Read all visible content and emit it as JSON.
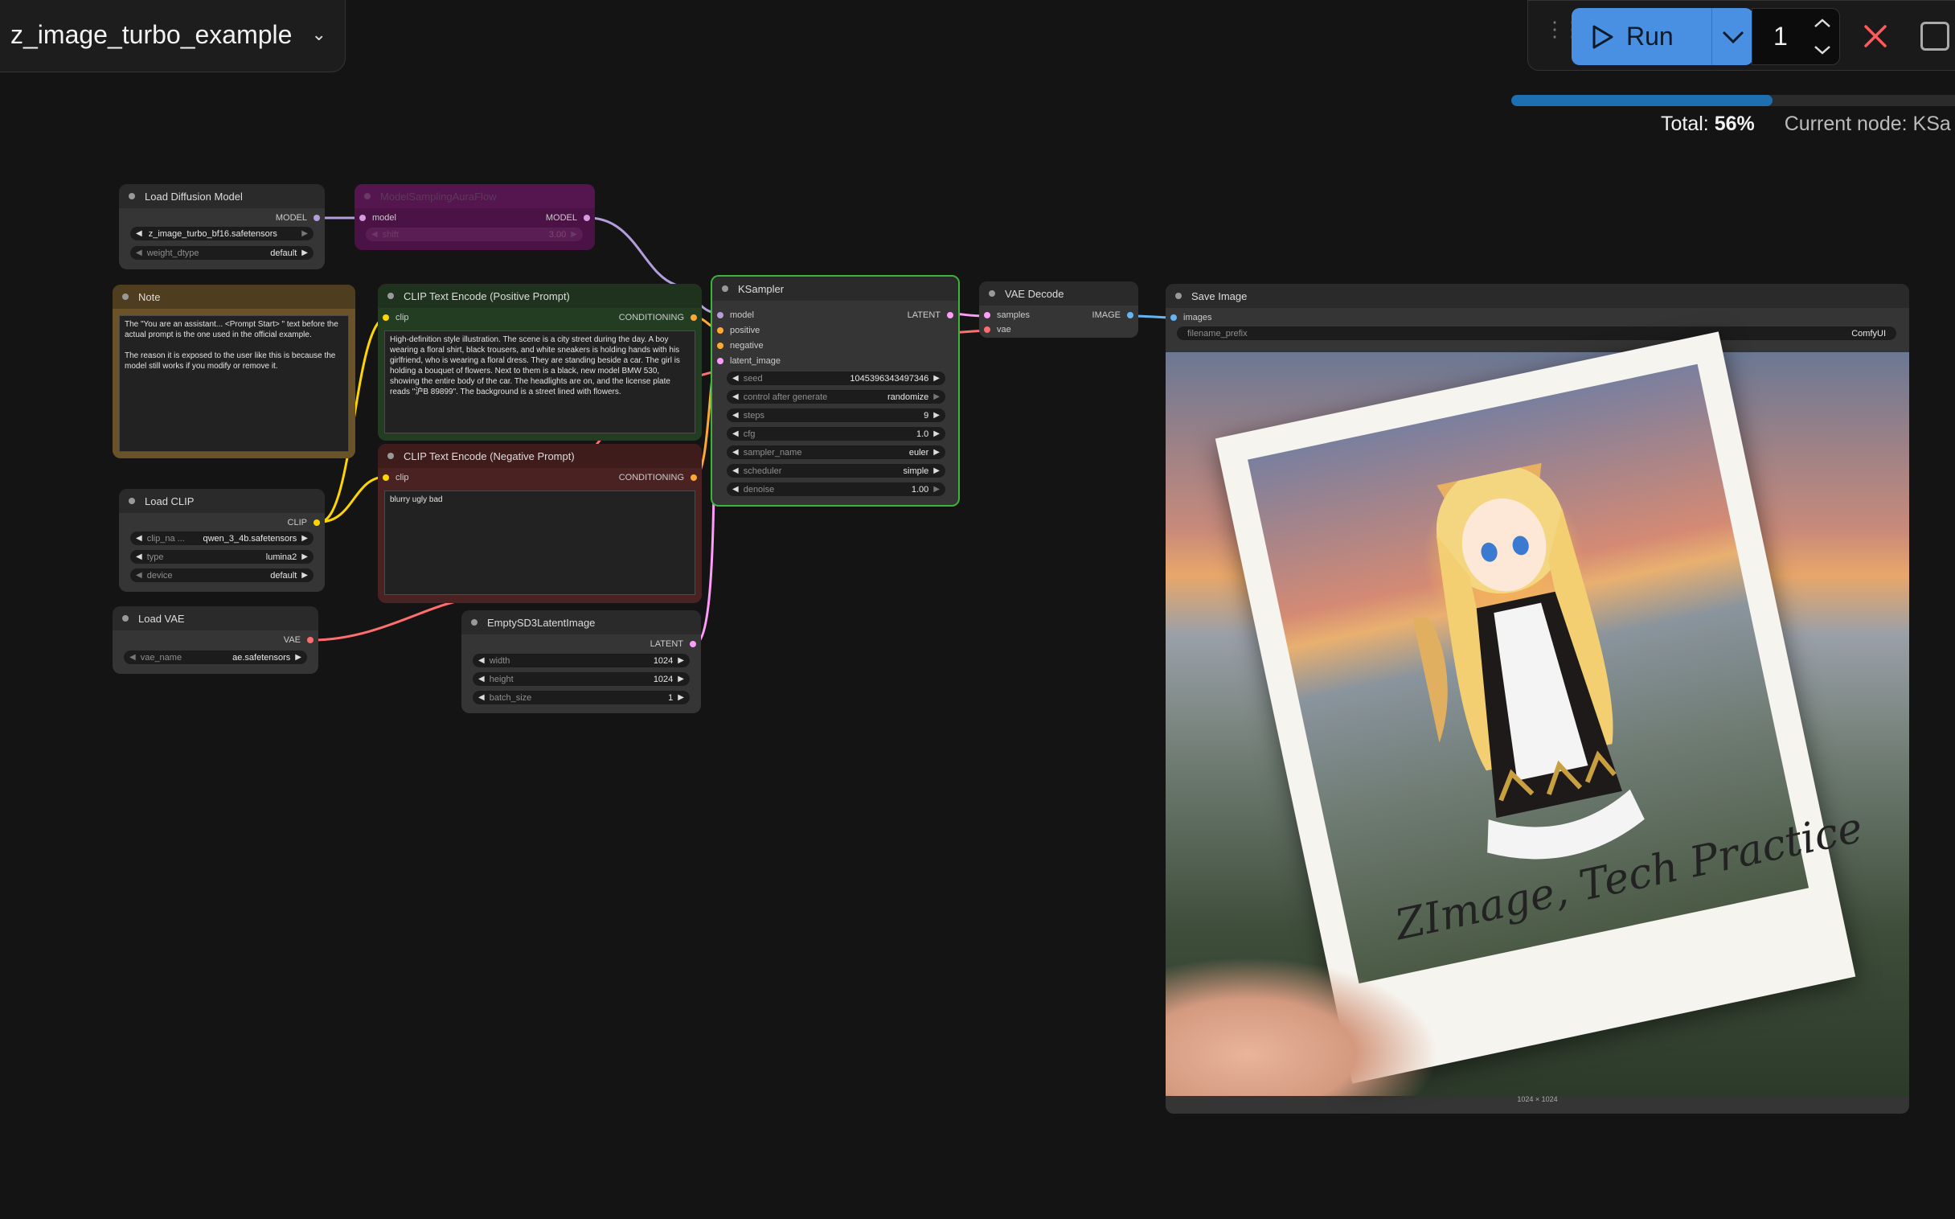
{
  "workflow": {
    "title": "z_image_turbo_example"
  },
  "toolbar": {
    "run_label": "Run",
    "queue_count": "1"
  },
  "progress": {
    "total_label": "Total:",
    "total_value": "56%",
    "total_fraction": 0.56,
    "current_node_label": "Current node: KSa"
  },
  "nodes": {
    "load_diffusion": {
      "title": "Load Diffusion Model",
      "out_model": "MODEL",
      "unet_name": "z_image_turbo_bf16.safetensors",
      "weight_dtype_label": "weight_dtype",
      "weight_dtype_value": "default"
    },
    "model_sampling": {
      "title": "ModelSamplingAuraFlow",
      "in_model": "model",
      "out_model": "MODEL",
      "shift_label": "shift",
      "shift_value": "3.00"
    },
    "note": {
      "title": "Note",
      "text": "The \"You are an assistant... <Prompt Start> \" text before the actual prompt is the one used in the official example.\n\nThe reason it is exposed to the user like this is because the model still works if you modify or remove it."
    },
    "clip_pos": {
      "title": "CLIP Text Encode (Positive Prompt)",
      "in_clip": "clip",
      "out": "CONDITIONING",
      "text": "High-definition style illustration. The scene is a city street during the day. A boy wearing a floral shirt, black trousers, and white sneakers is holding hands with his girlfriend, who is wearing a floral dress. They are standing beside a car. The girl is holding a bouquet of flowers. Next to them is a black, new model BMW 530, showing the entire body of the car. The headlights are on, and the license plate reads \"沪B 89899\". The background is a street lined with flowers."
    },
    "clip_neg": {
      "title": "CLIP Text Encode (Negative Prompt)",
      "in_clip": "clip",
      "out": "CONDITIONING",
      "text": "blurry ugly bad"
    },
    "load_clip": {
      "title": "Load CLIP",
      "out": "CLIP",
      "clip_name_label": "clip_na ...",
      "clip_name_value": "qwen_3_4b.safetensors",
      "type_label": "type",
      "type_value": "lumina2",
      "device_label": "device",
      "device_value": "default"
    },
    "load_vae": {
      "title": "Load VAE",
      "out": "VAE",
      "vae_name_label": "vae_name",
      "vae_name_value": "ae.safetensors"
    },
    "empty_latent": {
      "title": "EmptySD3LatentImage",
      "out": "LATENT",
      "width_label": "width",
      "width_value": "1024",
      "height_label": "height",
      "height_value": "1024",
      "batch_label": "batch_size",
      "batch_value": "1"
    },
    "ksampler": {
      "title": "KSampler",
      "in_model": "model",
      "in_positive": "positive",
      "in_negative": "negative",
      "in_latent": "latent_image",
      "out": "LATENT",
      "seed_label": "seed",
      "seed_value": "1045396343497346",
      "control_label": "control after generate",
      "control_value": "randomize",
      "steps_label": "steps",
      "steps_value": "9",
      "cfg_label": "cfg",
      "cfg_value": "1.0",
      "sampler_label": "sampler_name",
      "sampler_value": "euler",
      "scheduler_label": "scheduler",
      "scheduler_value": "simple",
      "denoise_label": "denoise",
      "denoise_value": "1.00"
    },
    "vae_decode": {
      "title": "VAE Decode",
      "in_samples": "samples",
      "in_vae": "vae",
      "out": "IMAGE"
    },
    "save_image": {
      "title": "Save Image",
      "in_images": "images",
      "prefix_label": "filename_prefix",
      "prefix_value": "ComfyUI",
      "caption": "ZImage, Tech Practice",
      "dims": "1024 × 1024"
    }
  },
  "colors": {
    "model": "#b39ddb",
    "clip": "#ffd500",
    "conditioning": "#ffa931",
    "latent": "#ff9cf9",
    "vae": "#ff6e6e",
    "image": "#64b5f6",
    "accent": "#4a90e2"
  }
}
